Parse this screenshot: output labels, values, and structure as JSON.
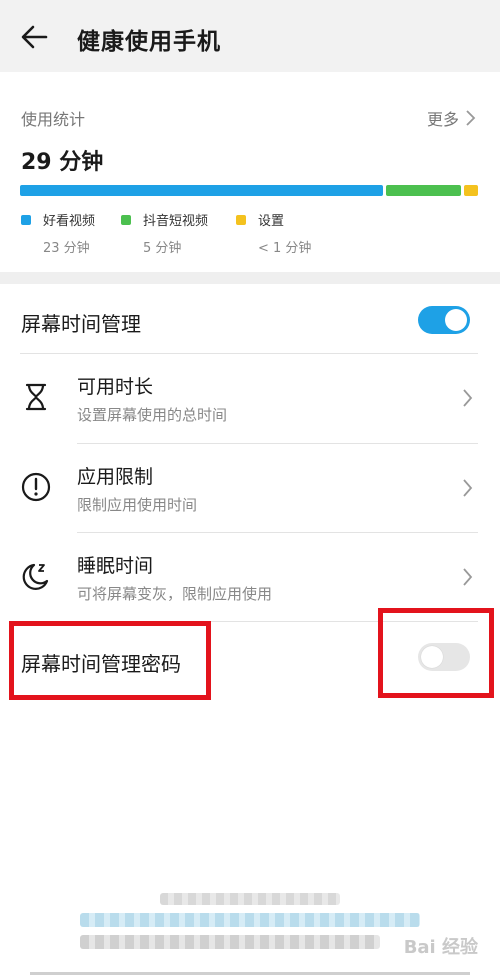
{
  "header": {
    "title": "健康使用手机",
    "back_icon": "arrow-left-icon"
  },
  "usage_stats": {
    "label": "使用统计",
    "more_label": "更多",
    "total": "29 分钟",
    "segments": [
      {
        "name": "好看视频",
        "duration": "23 分钟",
        "color": "#1ea1e6"
      },
      {
        "name": "抖音短视频",
        "duration": "5 分钟",
        "color": "#4cc04f"
      },
      {
        "name": "设置",
        "duration": "< 1 分钟",
        "color": "#f4c21e"
      }
    ]
  },
  "screen_time": {
    "label": "屏幕时间管理",
    "enabled": true,
    "accent_color": "#1ea1e6"
  },
  "items": [
    {
      "title": "可用时长",
      "subtitle": "设置屏幕使用的总时间",
      "icon": "hourglass-icon"
    },
    {
      "title": "应用限制",
      "subtitle": "限制应用使用时间",
      "icon": "alert-circle-icon"
    },
    {
      "title": "睡眠时间",
      "subtitle": "可将屏幕变灰，限制应用使用",
      "icon": "moon-sleep-icon"
    }
  ],
  "password": {
    "label": "屏幕时间管理密码",
    "enabled": false
  },
  "watermark": "Bai 经验",
  "highlight_color": "#e3131c"
}
